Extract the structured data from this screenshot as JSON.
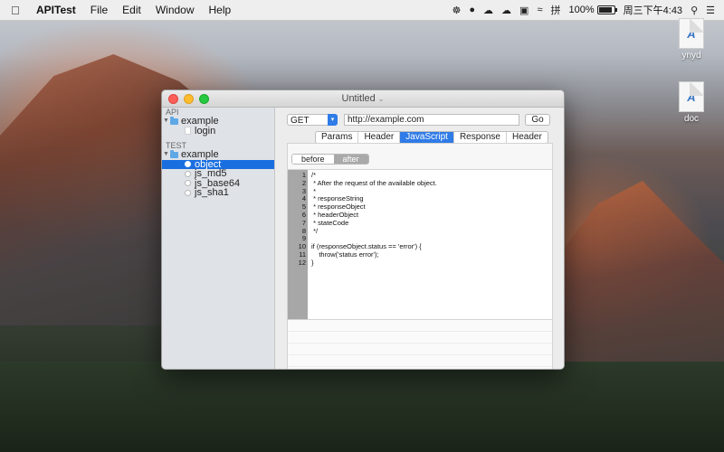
{
  "menubar": {
    "app_name": "APITest",
    "menus": [
      "File",
      "Edit",
      "Window",
      "Help"
    ],
    "battery_percent": "100%",
    "input_method": "拼",
    "clock": "周三下午4:43"
  },
  "desktop": {
    "icons": [
      {
        "label": "ynyd",
        "glyph": "A̲"
      },
      {
        "label": "doc",
        "glyph": "A̲"
      }
    ]
  },
  "window": {
    "title": "Untitled",
    "sidebar": {
      "api_header": "API",
      "api_folder": "example",
      "api_files": [
        "login"
      ],
      "test_header": "TEST",
      "test_folder": "example",
      "test_items": [
        "object",
        "js_md5",
        "js_base64",
        "js_sha1"
      ],
      "selected": "object"
    },
    "request": {
      "method": "GET",
      "url": "http://example.com",
      "go_label": "Go"
    },
    "tabs": [
      "Params",
      "Header",
      "JavaScript",
      "Response",
      "Header"
    ],
    "active_tab": "JavaScript",
    "segments": {
      "before": "before",
      "after": "after"
    },
    "code_lines": [
      "/*",
      " * After the request of the available object.",
      " *",
      " * responseString",
      " * responseObject",
      " * headerObject",
      " * stateCode",
      " */",
      "",
      "if (responseObject.status == 'error') {",
      "    throw('status error');",
      "}"
    ],
    "line_numbers": [
      "1",
      "2",
      "3",
      "4",
      "5",
      "6",
      "7",
      "8",
      "9",
      "10",
      "11",
      "12"
    ]
  }
}
